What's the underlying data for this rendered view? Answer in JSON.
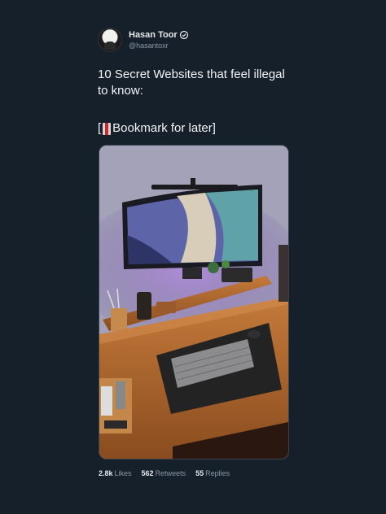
{
  "author": {
    "name": "Hasan Toor",
    "handle": "@hasantoxr",
    "verified_icon": "verified-badge-icon"
  },
  "tweet": {
    "text": "10 Secret Websites that feel illegal to know:",
    "bookmark_prefix": "[",
    "bookmark_emoji_icon": "bookmark-icon",
    "bookmark_text": " Bookmark for later]"
  },
  "media": {
    "description_icon": "desk-setup-photo"
  },
  "stats": {
    "likes_value": "2.8k",
    "likes_label": "Likes",
    "retweets_value": "562",
    "retweets_label": "Retweets",
    "replies_value": "55",
    "replies_label": "Replies"
  },
  "colors": {
    "background": "#15202b",
    "text": "#e7e9ea",
    "muted": "#8b98a5"
  }
}
